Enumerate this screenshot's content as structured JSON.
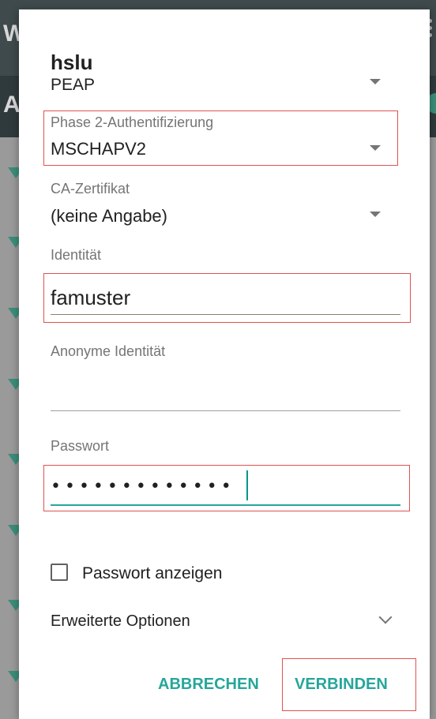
{
  "background": {
    "top_letter": "W",
    "sub_letter": "A"
  },
  "dialog": {
    "title": "hslu",
    "eap_method": {
      "value": "PEAP"
    },
    "phase2": {
      "label": "Phase 2-Authentifizierung",
      "value": "MSCHAPV2"
    },
    "ca_certificate": {
      "label": "CA-Zertifikat",
      "value": "(keine Angabe)"
    },
    "identity": {
      "label": "Identität",
      "value": "famuster"
    },
    "anonymous_identity": {
      "label": "Anonyme Identität",
      "value": ""
    },
    "password": {
      "label": "Passwort",
      "masked_value": "•••••••••••••"
    },
    "show_password": {
      "label": "Passwort anzeigen",
      "checked": false
    },
    "advanced_options": {
      "label": "Erweiterte Optionen",
      "icon": "chevron-down-icon"
    },
    "buttons": {
      "cancel": "ABBRECHEN",
      "connect": "VERBINDEN"
    }
  },
  "colors": {
    "accent": "#26a69a",
    "highlight": "#e05252",
    "text_primary": "#212121",
    "text_secondary": "#757575"
  }
}
